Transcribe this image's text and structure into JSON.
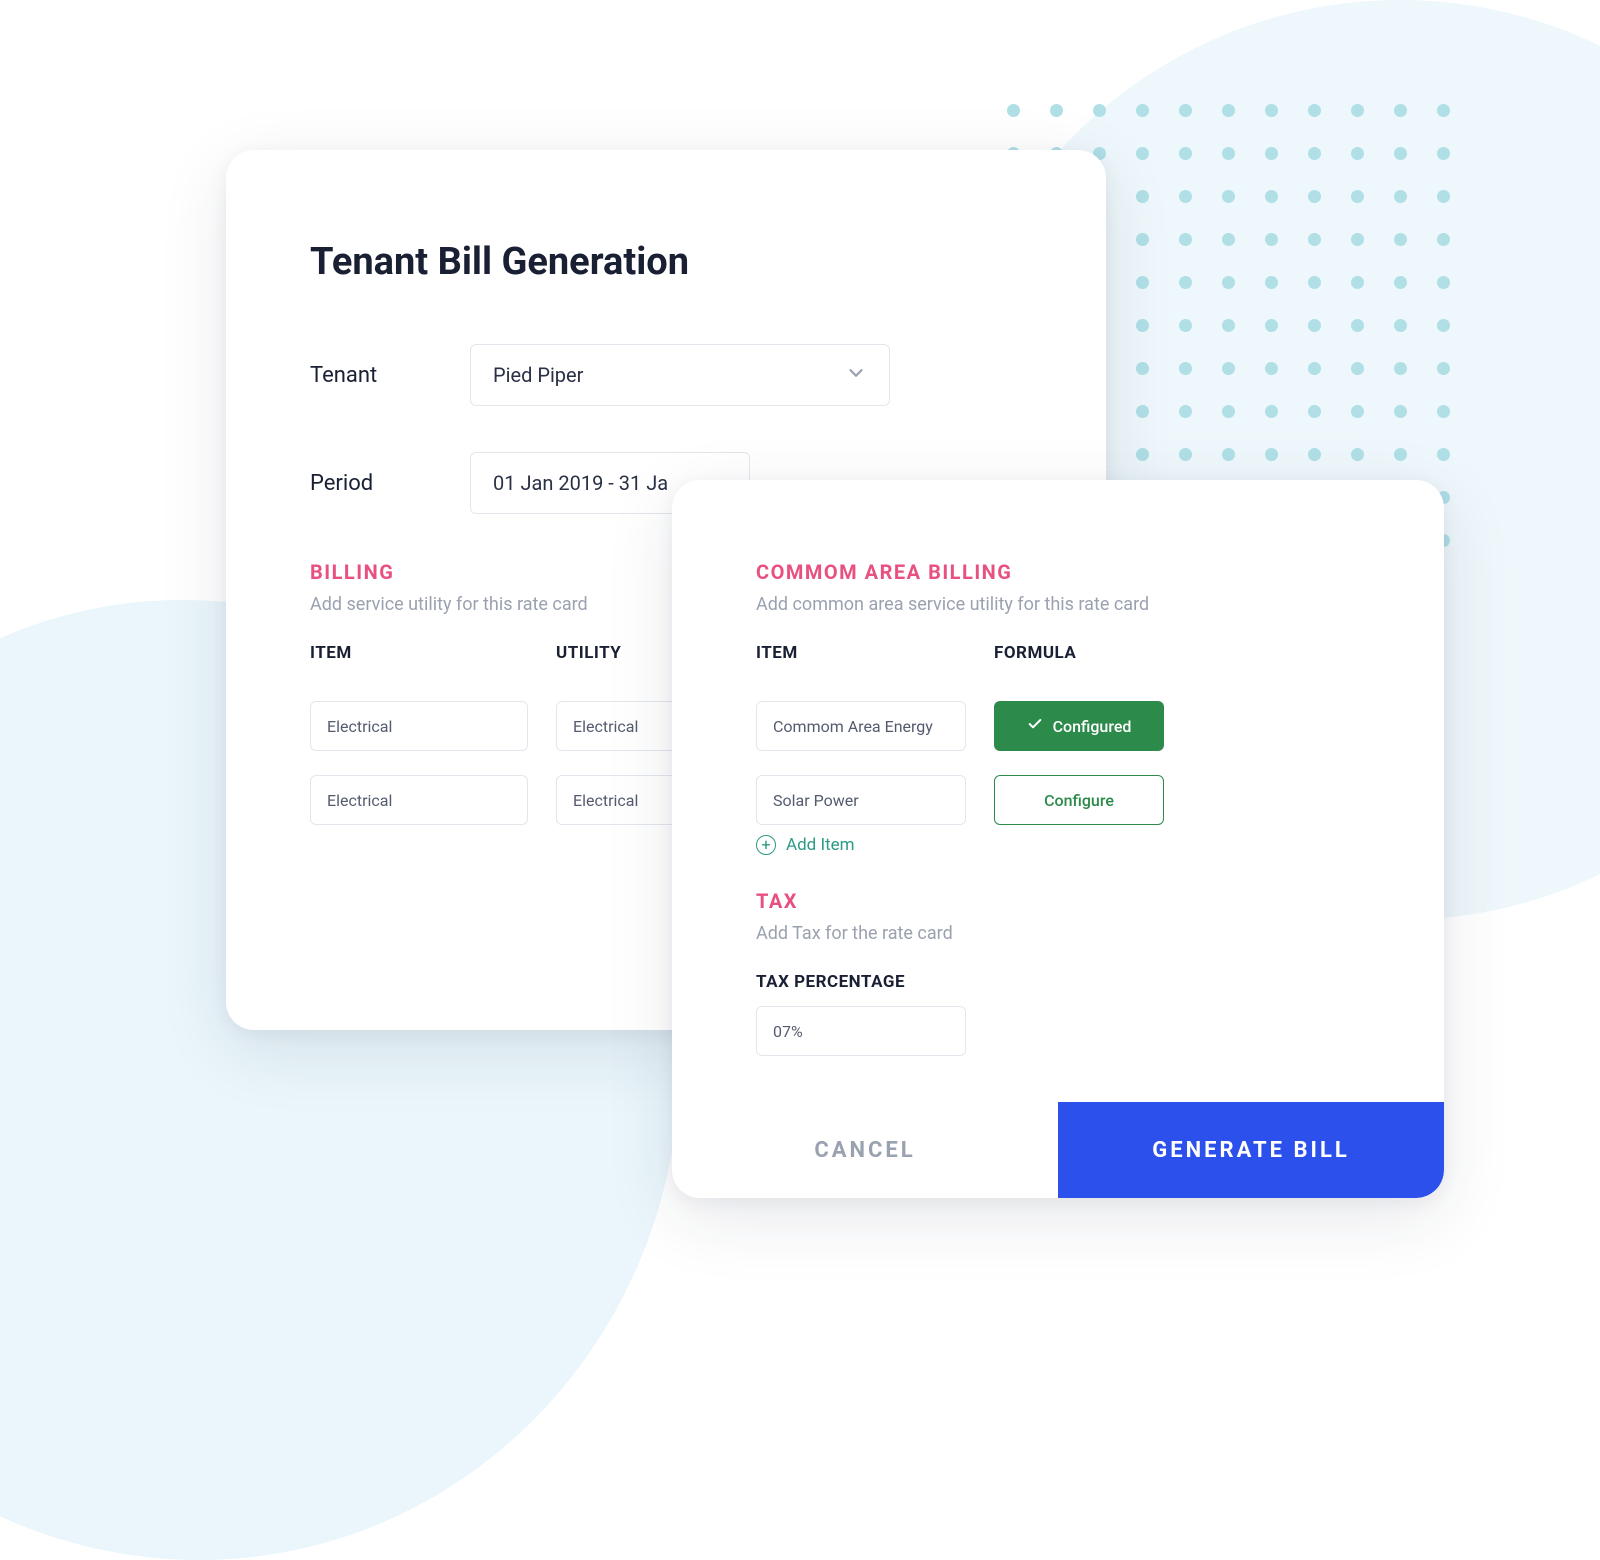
{
  "backCard": {
    "title": "Tenant Bill Generation",
    "tenantLabel": "Tenant",
    "tenantValue": "Pied Piper",
    "periodLabel": "Period",
    "periodValue": "01 Jan 2019 - 31 Ja",
    "billing": {
      "heading": "BILLING",
      "sub": "Add service utility for this rate card",
      "colItem": "ITEM",
      "colUtility": "UTILITY",
      "rows": [
        {
          "item": "Electrical",
          "utility": "Electrical"
        },
        {
          "item": "Electrical",
          "utility": "Electrical"
        }
      ]
    }
  },
  "frontCard": {
    "commonArea": {
      "heading": "COMMOM AREA BILLING",
      "sub": "Add common area service utility for this rate card",
      "colItem": "ITEM",
      "colFormula": "FORMULA",
      "rows": [
        {
          "item": "Commom Area Energy",
          "configuredLabel": "Configured",
          "configured": true
        },
        {
          "item": "Solar Power",
          "configureLabel": "Configure",
          "configured": false
        }
      ],
      "addItemLabel": "Add Item"
    },
    "tax": {
      "heading": "TAX",
      "sub": "Add Tax for the rate card",
      "fieldLabel": "TAX PERCENTAGE",
      "value": "07%"
    },
    "footer": {
      "cancel": "CANCEL",
      "generate": "GENERATE BILL"
    }
  }
}
